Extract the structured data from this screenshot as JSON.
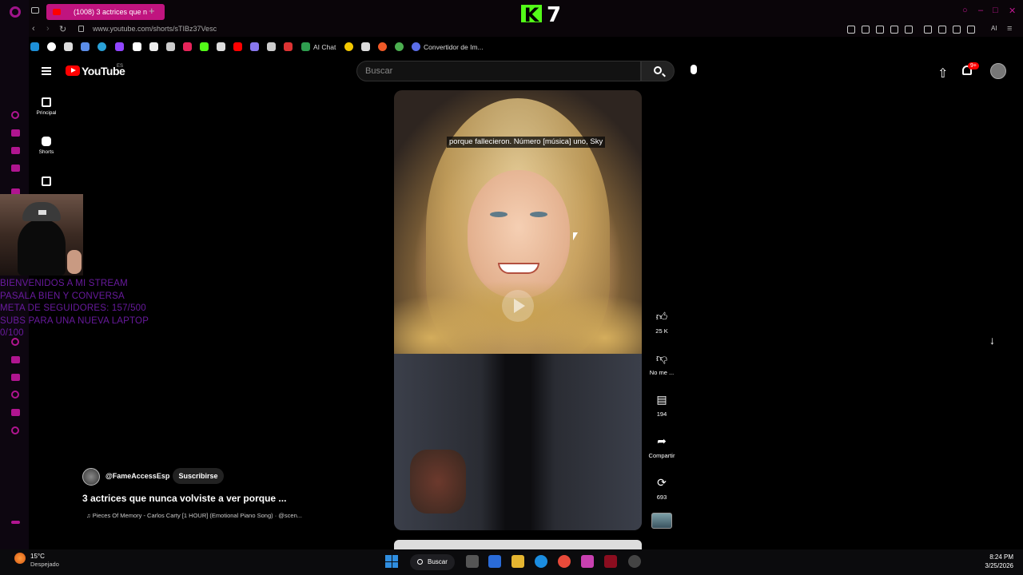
{
  "browser": {
    "tab_title": "(1008) 3 actrices que n",
    "url": "www.youtube.com/shorts/sTIBz37Vesc",
    "ai_label": "AI",
    "bookmarks_text": [
      "AI Chat",
      "Convertidor de Im..."
    ]
  },
  "overlay": {
    "kick_letter": "K",
    "kick_count": "7",
    "stream_text": [
      "BIENVENIDOS A MI STREAM",
      "PASALA BIEN Y CONVERSA",
      "META DE SEGUIDORES: 157/500",
      "SUBS PARA UNA NUEVA LAPTOP",
      "0/100"
    ]
  },
  "youtube": {
    "logo_text": "YouTube",
    "region": "ES",
    "search_placeholder": "Buscar",
    "notif_badge": "9+",
    "nav": [
      {
        "label": "Principal",
        "icon": "home-icon"
      },
      {
        "label": "Shorts",
        "icon": "shorts-icon"
      },
      {
        "label": "",
        "icon": "subscriptions-icon"
      }
    ]
  },
  "video": {
    "caption": "porque fallecieron. Número [música] uno, Sky",
    "channel": "@FameAccessEsp",
    "subscribe_label": "Suscribirse",
    "title": "3 actrices que nunca volviste a ver porque ...",
    "music": "♫ Pieces Of Memory - Carlos Carty [1 HOUR] (Emotional Piano Song) · @scen..."
  },
  "actions": {
    "like_count": "25 K",
    "dislike_label": "No me ...",
    "comments_count": "194",
    "share_label": "Compartir",
    "remix_count": "693"
  },
  "taskbar": {
    "temperature": "15°C",
    "weather": "Despejado",
    "search_label": "Buscar",
    "time": "8:24 PM",
    "date": "3/25/2026"
  },
  "colors": {
    "opera_accent": "#c0147f",
    "kick_green": "#53fc18",
    "yt_red": "#ff0000",
    "stream_text": "#7a1fb8"
  }
}
